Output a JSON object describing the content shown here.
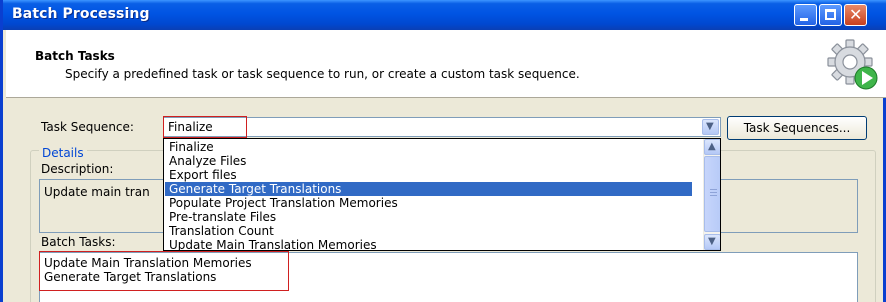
{
  "window": {
    "title": "Batch Processing"
  },
  "header": {
    "title": "Batch Tasks",
    "subtitle": "Specify a predefined task or task sequence to run, or create a custom task sequence.",
    "icon": "gear-icon"
  },
  "task_sequence": {
    "label": "Task Sequence:",
    "value": "Finalize",
    "button_label": "Task Sequences..."
  },
  "dropdown": {
    "items": [
      "Finalize",
      "Analyze Files",
      "Export files",
      "Generate Target Translations",
      "Populate Project Translation Memories",
      "Pre-translate Files",
      "Translation Count",
      "Update Main Translation Memories"
    ],
    "selected": "Generate Target Translations"
  },
  "details": {
    "legend": "Details",
    "description_label": "Description:",
    "description_text": "Update main tran",
    "batch_tasks_label": "Batch Tasks:",
    "batch_tasks": [
      "Update Main Translation Memories",
      "Generate Target Translations"
    ]
  },
  "colors": {
    "titlebar": "#0054e3",
    "selection": "#316ac5",
    "highlight_border": "#d02020",
    "legend_text": "#0046d5"
  }
}
